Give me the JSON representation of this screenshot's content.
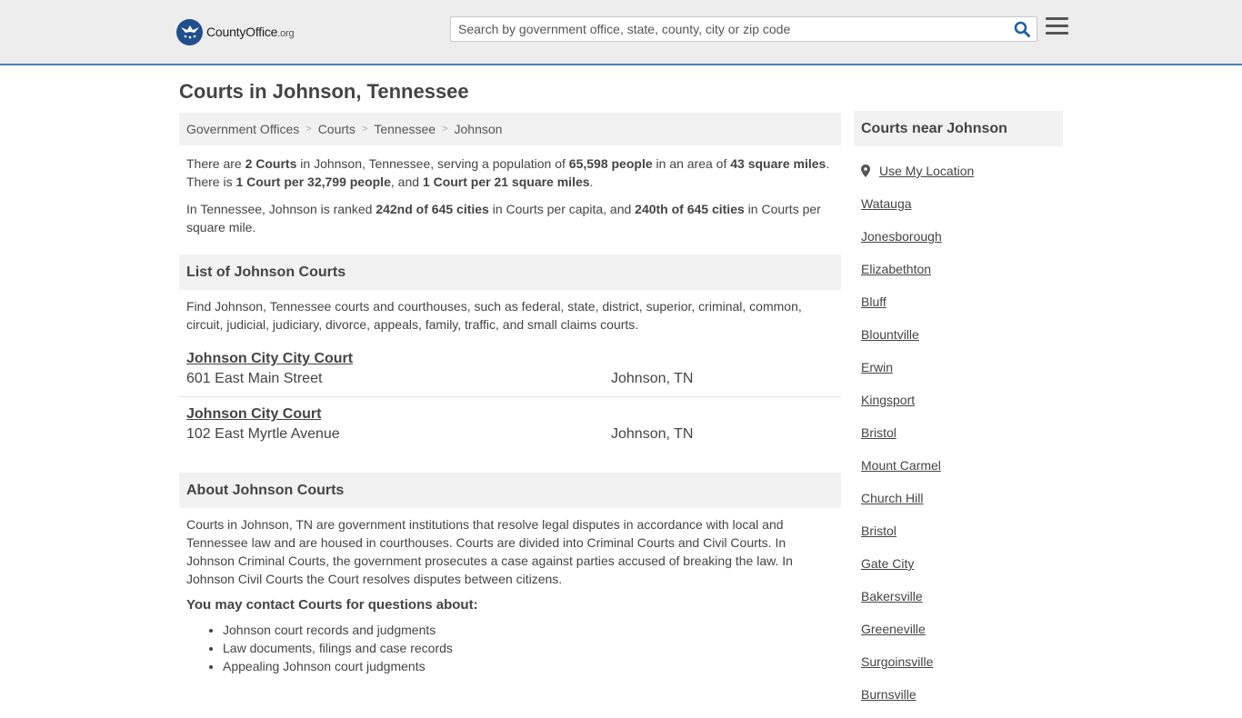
{
  "header": {
    "logo": {
      "brand": "CountyOffice",
      "tld": ".org"
    },
    "search": {
      "placeholder": "Search by government office, state, county, city or zip code",
      "value": ""
    },
    "icons": {
      "search": "search-icon",
      "menu": "hamburger-menu-icon",
      "logo": "eagle-seal-icon"
    }
  },
  "page": {
    "title": "Courts in Johnson, Tennessee"
  },
  "breadcrumb": [
    "Government Offices",
    "Courts",
    "Tennessee",
    "Johnson"
  ],
  "intro": {
    "p1": {
      "t1": "There are ",
      "b1": "2 Courts",
      "t2": " in Johnson, Tennessee, serving a population of ",
      "b2": "65,598 people",
      "t3": " in an area of ",
      "b3": "43 square miles",
      "t4": ". There is ",
      "b4": "1 Court per 32,799 people",
      "t5": ", and ",
      "b5": "1 Court per 21 square miles",
      "t6": "."
    },
    "p2": {
      "t1": "In Tennessee, Johnson is ranked ",
      "b1": "242nd of 645 cities",
      "t2": " in Courts per capita, and ",
      "b2": "240th of 645 cities",
      "t3": " in Courts per square mile."
    }
  },
  "list": {
    "heading": "List of Johnson Courts",
    "description": "Find Johnson, Tennessee courts and courthouses, such as federal, state, district, superior, criminal, common, circuit, judicial, judiciary, divorce, appeals, family, traffic, and small claims courts.",
    "courts": [
      {
        "name": "Johnson City City Court",
        "address": "601 East Main Street",
        "city": "Johnson, TN"
      },
      {
        "name": "Johnson City Court",
        "address": "102 East Myrtle Avenue",
        "city": "Johnson, TN"
      }
    ]
  },
  "about": {
    "heading": "About Johnson Courts",
    "text": "Courts in Johnson, TN are government institutions that resolve legal disputes in accordance with local and Tennessee law and are housed in courthouses. Courts are divided into Criminal Courts and Civil Courts. In Johnson Criminal Courts, the government prosecutes a case against parties accused of breaking the law. In Johnson Civil Courts the Court resolves disputes between citizens.",
    "subheading": "You may contact Courts for questions about:",
    "topics": [
      "Johnson court records and judgments",
      "Law documents, filings and case records",
      "Appealing Johnson court judgments"
    ]
  },
  "sidebar": {
    "heading": "Courts near Johnson",
    "location_label": "Use My Location",
    "cities": [
      "Watauga",
      "Jonesborough",
      "Elizabethton",
      "Bluff",
      "Blountville",
      "Erwin",
      "Kingsport",
      "Bristol",
      "Mount Carmel",
      "Church Hill",
      "Bristol",
      "Gate City",
      "Bakersville",
      "Greeneville",
      "Surgoinsville",
      "Burnsville"
    ]
  }
}
